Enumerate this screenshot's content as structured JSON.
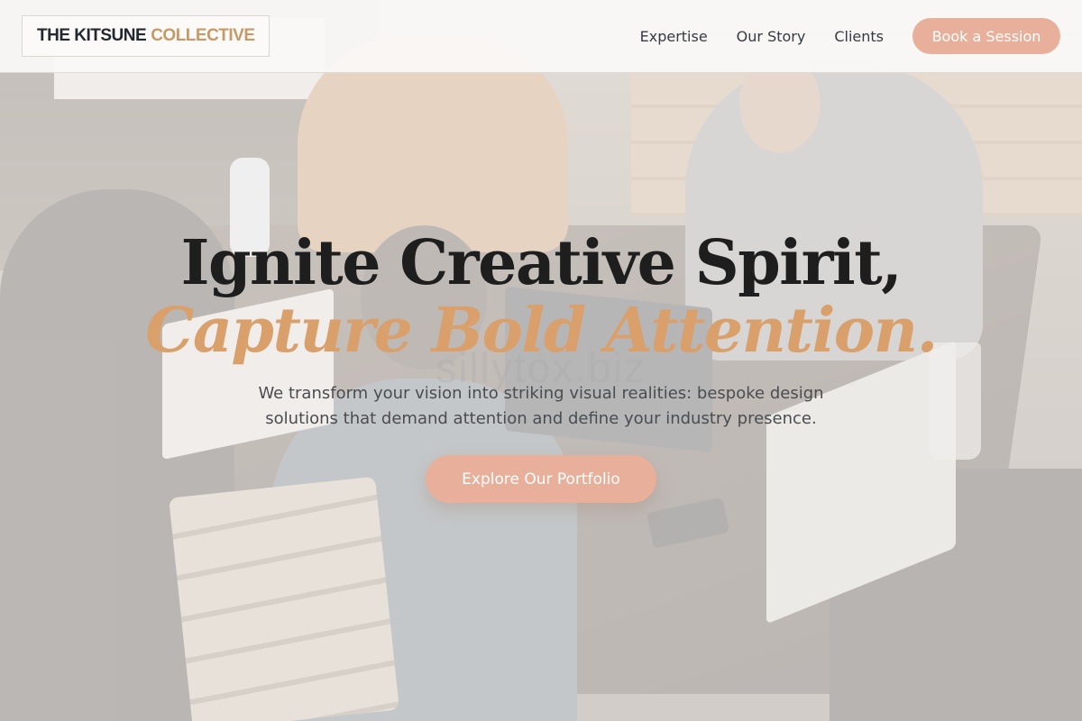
{
  "brand": {
    "name_main": "THE KITSUNE",
    "name_accent": "COLLECTIVE"
  },
  "nav": {
    "links": [
      {
        "label": "Expertise"
      },
      {
        "label": "Our Story"
      },
      {
        "label": "Clients"
      }
    ],
    "cta_label": "Book a Session"
  },
  "hero": {
    "headline_line1": "Ignite Creative Spirit,",
    "headline_line2": "Capture Bold Attention.",
    "watermark": "sillytox.biz",
    "subtext": "We transform your vision into striking visual realities: bespoke design solutions that demand attention and define your industry presence.",
    "button_label": "Explore Our Portfolio"
  },
  "colors": {
    "accent": "#e8b09a",
    "accent_text": "#d9a06c",
    "logo_accent": "#c69a67",
    "dark_text": "#1e1e1e"
  }
}
